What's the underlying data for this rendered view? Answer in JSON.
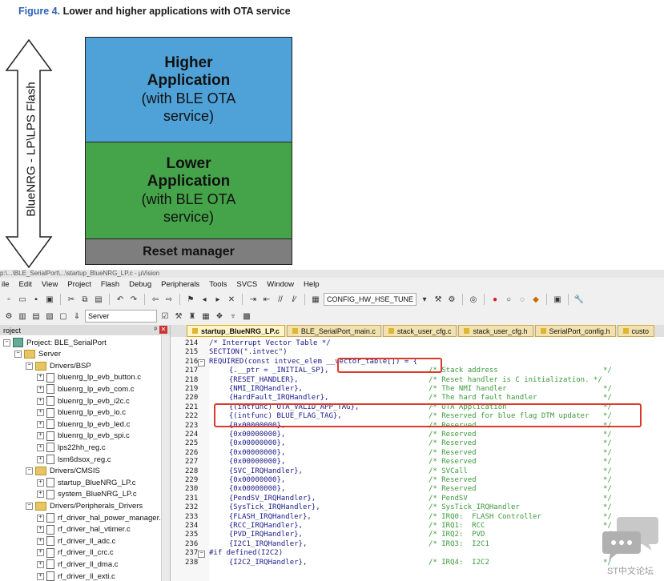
{
  "figure": {
    "caption_prefix": "Figure 4.",
    "caption_rest": "Lower and higher applications with OTA service",
    "flash_label": "BlueNRG - LP\\LPS Flash",
    "higher": {
      "line1": "Higher",
      "line2": "Application",
      "line3": "(with BLE OTA",
      "line4": "service)"
    },
    "lower": {
      "line1": "Lower",
      "line2": "Application",
      "line3": "(with BLE OTA",
      "line4": "service)"
    },
    "reset": "Reset manager",
    "colors": {
      "higher": "#4fa2d8",
      "lower": "#45a34a",
      "reset": "#7e7e7e",
      "caption": "#2f62b8"
    }
  },
  "ide": {
    "title_text": "p:\\...\\BLE_SerialPort\\...\\startup_BlueNRG_LP.c - µVision",
    "menu": [
      "ile",
      "Edit",
      "View",
      "Project",
      "Flash",
      "Debug",
      "Peripherals",
      "Tools",
      "SVCS",
      "Window",
      "Help"
    ],
    "toolbar": {
      "target_combo": "CONFIG_HW_HSE_TUNE",
      "server_label": "Server"
    },
    "project": {
      "title": "roject",
      "items": [
        {
          "label": "Project: BLE_SerialPort",
          "type": "proj",
          "indent": 0
        },
        {
          "label": "Server",
          "type": "folder",
          "indent": 1
        },
        {
          "label": "Drivers/BSP",
          "type": "folder",
          "indent": 2
        },
        {
          "label": "bluenrg_lp_evb_button.c",
          "type": "file",
          "indent": 3
        },
        {
          "label": "bluenrg_lp_evb_com.c",
          "type": "file",
          "indent": 3
        },
        {
          "label": "bluenrg_lp_evb_i2c.c",
          "type": "file",
          "indent": 3
        },
        {
          "label": "bluenrg_lp_evb_io.c",
          "type": "file",
          "indent": 3
        },
        {
          "label": "bluenrg_lp_evb_led.c",
          "type": "file",
          "indent": 3
        },
        {
          "label": "bluenrg_lp_evb_spi.c",
          "type": "file",
          "indent": 3
        },
        {
          "label": "lps22hh_reg.c",
          "type": "file",
          "indent": 3
        },
        {
          "label": "lsm6dsox_reg.c",
          "type": "file",
          "indent": 3
        },
        {
          "label": "Drivers/CMSIS",
          "type": "folder",
          "indent": 2
        },
        {
          "label": "startup_BlueNRG_LP.c",
          "type": "file",
          "indent": 3
        },
        {
          "label": "system_BlueNRG_LP.c",
          "type": "file",
          "indent": 3
        },
        {
          "label": "Drivers/Peripherals_Drivers",
          "type": "folder",
          "indent": 2
        },
        {
          "label": "rf_driver_hal_power_manager.c",
          "type": "file",
          "indent": 3
        },
        {
          "label": "rf_driver_hal_vtimer.c",
          "type": "file",
          "indent": 3
        },
        {
          "label": "rf_driver_ll_adc.c",
          "type": "file",
          "indent": 3
        },
        {
          "label": "rf_driver_ll_crc.c",
          "type": "file",
          "indent": 3
        },
        {
          "label": "rf_driver_ll_dma.c",
          "type": "file",
          "indent": 3
        },
        {
          "label": "rf_driver_ll_exti.c",
          "type": "file",
          "indent": 3
        }
      ]
    },
    "tabs": [
      "startup_BlueNRG_LP.c",
      "BLE_SerialPort_main.c",
      "stack_user_cfg.c",
      "stack_user_cfg.h",
      "SerialPort_config.h",
      "custo"
    ],
    "code": [
      {
        "n": "214",
        "code": "/* Interrupt Vector Table */",
        "cmt": "",
        "end": ""
      },
      {
        "n": "215",
        "code": "SECTION(\".intvec\")",
        "cmt": "",
        "end": ""
      },
      {
        "n": "216",
        "code": "REQUIRED(const intvec_elem __vector_table[]) = {",
        "cmt": "",
        "end": ""
      },
      {
        "n": "217",
        "code": "  {.__ptr = _INITIAL_SP},",
        "cmt": "/* Stack address",
        "end": "*/"
      },
      {
        "n": "218",
        "code": "  {RESET_HANDLER},",
        "cmt": "/* Reset handler is C initialization. */",
        "end": ""
      },
      {
        "n": "219",
        "code": "  {NMI_IRQHandler},",
        "cmt": "/* The NMI handler",
        "end": "*/"
      },
      {
        "n": "220",
        "code": "  {HardFault_IRQHandler},",
        "cmt": "/* The hard fault handler",
        "end": "*/"
      },
      {
        "n": "221",
        "code": "  {(intfunc) OTA_VALID_APP_TAG},",
        "cmt": "/* OTA Application",
        "end": "*/"
      },
      {
        "n": "222",
        "code": "  {(intfunc) BLUE_FLAG_TAG},",
        "cmt": "/* Reserved for blue flag DTM updater",
        "end": "*/"
      },
      {
        "n": "223",
        "code": "  {0x00000000},",
        "cmt": "/* Reserved",
        "end": "*/"
      },
      {
        "n": "224",
        "code": "  {0x00000000},",
        "cmt": "/* Reserved",
        "end": "*/"
      },
      {
        "n": "225",
        "code": "  {0x00000000},",
        "cmt": "/* Reserved",
        "end": "*/"
      },
      {
        "n": "226",
        "code": "  {0x00000000},",
        "cmt": "/* Reserved",
        "end": "*/"
      },
      {
        "n": "227",
        "code": "  {0x00000000},",
        "cmt": "/* Reserved",
        "end": "*/"
      },
      {
        "n": "228",
        "code": "  {SVC_IRQHandler},",
        "cmt": "/* SVCall",
        "end": "*/"
      },
      {
        "n": "229",
        "code": "  {0x00000000},",
        "cmt": "/* Reserved",
        "end": "*/"
      },
      {
        "n": "230",
        "code": "  {0x00000000},",
        "cmt": "/* Reserved",
        "end": "*/"
      },
      {
        "n": "231",
        "code": "  {PendSV_IRQHandler},",
        "cmt": "/* PendSV",
        "end": "*/"
      },
      {
        "n": "232",
        "code": "  {SysTick_IRQHandler},",
        "cmt": "/* SysTick_IRQHandler",
        "end": "*/"
      },
      {
        "n": "233",
        "code": "  {FLASH_IRQHandler},",
        "cmt": "/* IRQ0:  FLASH Controller",
        "end": "*/"
      },
      {
        "n": "234",
        "code": "  {RCC_IRQHandler},",
        "cmt": "/* IRQ1:  RCC",
        "end": "*/"
      },
      {
        "n": "235",
        "code": "  {PVD_IRQHandler},",
        "cmt": "/* IRQ2:  PVD",
        "end": "*/"
      },
      {
        "n": "236",
        "code": "  {I2C1_IRQHandler},",
        "cmt": "/* IRQ3:  I2C1",
        "end": "*/"
      },
      {
        "n": "237",
        "code": "#if defined(I2C2)",
        "cmt": "",
        "end": ""
      },
      {
        "n": "238",
        "code": "  {I2C2_IRQHandler},",
        "cmt": "/* IRQ4:  I2C2",
        "end": "*/"
      }
    ]
  },
  "watermark": "ST中文论坛"
}
